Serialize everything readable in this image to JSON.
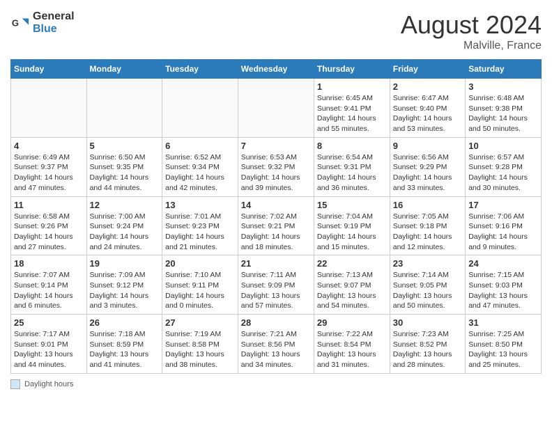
{
  "header": {
    "logo_general": "General",
    "logo_blue": "Blue",
    "month_title": "August 2024",
    "location": "Malville, France"
  },
  "footer": {
    "daylight_label": "Daylight hours"
  },
  "days_of_week": [
    "Sunday",
    "Monday",
    "Tuesday",
    "Wednesday",
    "Thursday",
    "Friday",
    "Saturday"
  ],
  "weeks": [
    [
      {
        "day": "",
        "info": ""
      },
      {
        "day": "",
        "info": ""
      },
      {
        "day": "",
        "info": ""
      },
      {
        "day": "",
        "info": ""
      },
      {
        "day": "1",
        "info": "Sunrise: 6:45 AM\nSunset: 9:41 PM\nDaylight: 14 hours and 55 minutes."
      },
      {
        "day": "2",
        "info": "Sunrise: 6:47 AM\nSunset: 9:40 PM\nDaylight: 14 hours and 53 minutes."
      },
      {
        "day": "3",
        "info": "Sunrise: 6:48 AM\nSunset: 9:38 PM\nDaylight: 14 hours and 50 minutes."
      }
    ],
    [
      {
        "day": "4",
        "info": "Sunrise: 6:49 AM\nSunset: 9:37 PM\nDaylight: 14 hours and 47 minutes."
      },
      {
        "day": "5",
        "info": "Sunrise: 6:50 AM\nSunset: 9:35 PM\nDaylight: 14 hours and 44 minutes."
      },
      {
        "day": "6",
        "info": "Sunrise: 6:52 AM\nSunset: 9:34 PM\nDaylight: 14 hours and 42 minutes."
      },
      {
        "day": "7",
        "info": "Sunrise: 6:53 AM\nSunset: 9:32 PM\nDaylight: 14 hours and 39 minutes."
      },
      {
        "day": "8",
        "info": "Sunrise: 6:54 AM\nSunset: 9:31 PM\nDaylight: 14 hours and 36 minutes."
      },
      {
        "day": "9",
        "info": "Sunrise: 6:56 AM\nSunset: 9:29 PM\nDaylight: 14 hours and 33 minutes."
      },
      {
        "day": "10",
        "info": "Sunrise: 6:57 AM\nSunset: 9:28 PM\nDaylight: 14 hours and 30 minutes."
      }
    ],
    [
      {
        "day": "11",
        "info": "Sunrise: 6:58 AM\nSunset: 9:26 PM\nDaylight: 14 hours and 27 minutes."
      },
      {
        "day": "12",
        "info": "Sunrise: 7:00 AM\nSunset: 9:24 PM\nDaylight: 14 hours and 24 minutes."
      },
      {
        "day": "13",
        "info": "Sunrise: 7:01 AM\nSunset: 9:23 PM\nDaylight: 14 hours and 21 minutes."
      },
      {
        "day": "14",
        "info": "Sunrise: 7:02 AM\nSunset: 9:21 PM\nDaylight: 14 hours and 18 minutes."
      },
      {
        "day": "15",
        "info": "Sunrise: 7:04 AM\nSunset: 9:19 PM\nDaylight: 14 hours and 15 minutes."
      },
      {
        "day": "16",
        "info": "Sunrise: 7:05 AM\nSunset: 9:18 PM\nDaylight: 14 hours and 12 minutes."
      },
      {
        "day": "17",
        "info": "Sunrise: 7:06 AM\nSunset: 9:16 PM\nDaylight: 14 hours and 9 minutes."
      }
    ],
    [
      {
        "day": "18",
        "info": "Sunrise: 7:07 AM\nSunset: 9:14 PM\nDaylight: 14 hours and 6 minutes."
      },
      {
        "day": "19",
        "info": "Sunrise: 7:09 AM\nSunset: 9:12 PM\nDaylight: 14 hours and 3 minutes."
      },
      {
        "day": "20",
        "info": "Sunrise: 7:10 AM\nSunset: 9:11 PM\nDaylight: 14 hours and 0 minutes."
      },
      {
        "day": "21",
        "info": "Sunrise: 7:11 AM\nSunset: 9:09 PM\nDaylight: 13 hours and 57 minutes."
      },
      {
        "day": "22",
        "info": "Sunrise: 7:13 AM\nSunset: 9:07 PM\nDaylight: 13 hours and 54 minutes."
      },
      {
        "day": "23",
        "info": "Sunrise: 7:14 AM\nSunset: 9:05 PM\nDaylight: 13 hours and 50 minutes."
      },
      {
        "day": "24",
        "info": "Sunrise: 7:15 AM\nSunset: 9:03 PM\nDaylight: 13 hours and 47 minutes."
      }
    ],
    [
      {
        "day": "25",
        "info": "Sunrise: 7:17 AM\nSunset: 9:01 PM\nDaylight: 13 hours and 44 minutes."
      },
      {
        "day": "26",
        "info": "Sunrise: 7:18 AM\nSunset: 8:59 PM\nDaylight: 13 hours and 41 minutes."
      },
      {
        "day": "27",
        "info": "Sunrise: 7:19 AM\nSunset: 8:58 PM\nDaylight: 13 hours and 38 minutes."
      },
      {
        "day": "28",
        "info": "Sunrise: 7:21 AM\nSunset: 8:56 PM\nDaylight: 13 hours and 34 minutes."
      },
      {
        "day": "29",
        "info": "Sunrise: 7:22 AM\nSunset: 8:54 PM\nDaylight: 13 hours and 31 minutes."
      },
      {
        "day": "30",
        "info": "Sunrise: 7:23 AM\nSunset: 8:52 PM\nDaylight: 13 hours and 28 minutes."
      },
      {
        "day": "31",
        "info": "Sunrise: 7:25 AM\nSunset: 8:50 PM\nDaylight: 13 hours and 25 minutes."
      }
    ]
  ]
}
